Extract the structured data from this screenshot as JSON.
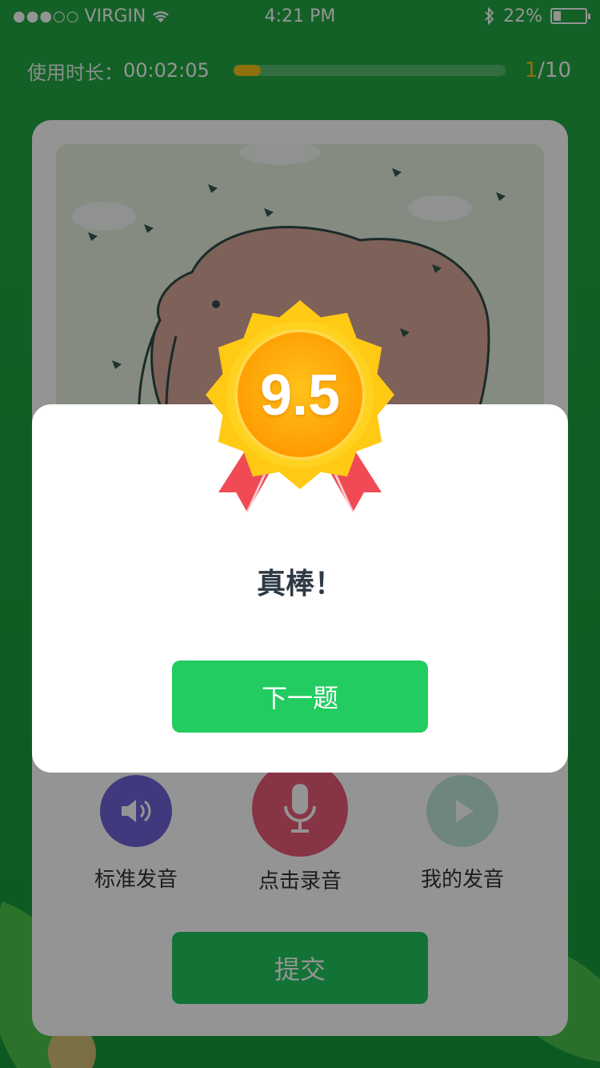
{
  "status_bar": {
    "signal": "●●●○○",
    "carrier": "VIRGIN",
    "time": "4:21 PM",
    "battery": "22%",
    "battery_level": 0.22
  },
  "header": {
    "time_label": "使用时长：",
    "time_value": "00:02:05",
    "progress_fraction": 0.1,
    "current": "1",
    "total": "/10",
    "accent_color": "#f5c21a"
  },
  "controls": {
    "standard": {
      "label": "标准发音",
      "icon": "speaker-icon",
      "color": "#6f63d9"
    },
    "record": {
      "label": "点击录音",
      "icon": "microphone-icon",
      "color": "#e85a78"
    },
    "mine": {
      "label": "我的发音",
      "icon": "play-icon",
      "color": "#bfe6dc"
    }
  },
  "submit_label": "提交",
  "modal": {
    "score": "9.5",
    "title": "真棒！",
    "next_label": "下一题",
    "button_color": "#22cc60"
  }
}
